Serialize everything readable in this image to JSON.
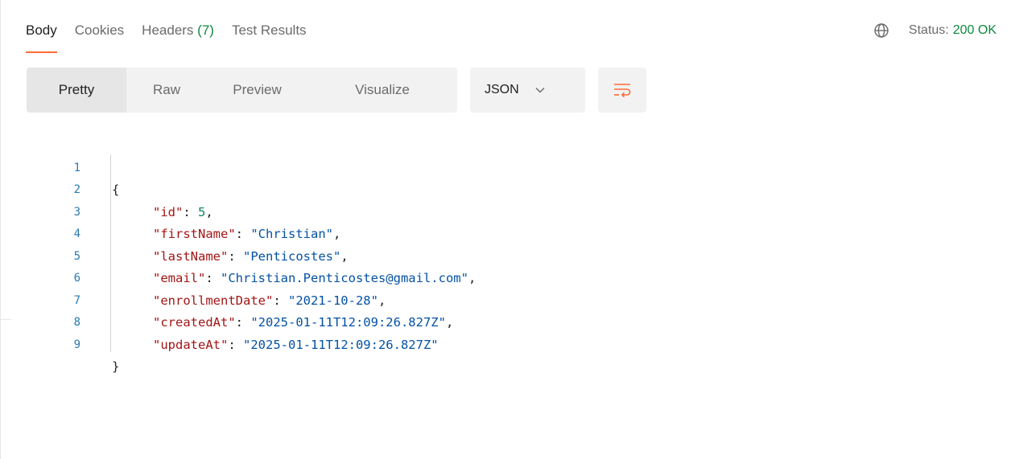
{
  "tabs": [
    {
      "label": "Body"
    },
    {
      "label": "Cookies"
    },
    {
      "label": "Headers",
      "count": "(7)"
    },
    {
      "label": "Test Results"
    }
  ],
  "status": {
    "label": "Status:",
    "value": "200 OK",
    "icon": "globe-icon"
  },
  "view_modes": [
    "Pretty",
    "Raw",
    "Preview",
    "Visualize"
  ],
  "format_select": {
    "value": "JSON",
    "icon": "chevron-down-icon"
  },
  "wrap_button": {
    "icon": "wrap-lines-icon",
    "color": "#ff6c37"
  },
  "code": {
    "line_numbers": [
      "1",
      "2",
      "3",
      "4",
      "5",
      "6",
      "7",
      "8",
      "9"
    ],
    "open_brace": "{",
    "close_brace": "}",
    "fields": [
      {
        "key": "\"id\"",
        "value": "5",
        "type": "number",
        "comma": ","
      },
      {
        "key": "\"firstName\"",
        "value": "\"Christian\"",
        "type": "string",
        "comma": ","
      },
      {
        "key": "\"lastName\"",
        "value": "\"Penticostes\"",
        "type": "string",
        "comma": ","
      },
      {
        "key": "\"email\"",
        "value": "\"Christian.Penticostes@gmail.com\"",
        "type": "string",
        "comma": ","
      },
      {
        "key": "\"enrollmentDate\"",
        "value": "\"2021-10-28\"",
        "type": "string",
        "comma": ","
      },
      {
        "key": "\"createdAt\"",
        "value": "\"2025-01-11T12:09:26.827Z\"",
        "type": "string",
        "comma": ","
      },
      {
        "key": "\"updateAt\"",
        "value": "\"2025-01-11T12:09:26.827Z\"",
        "type": "string",
        "comma": ""
      }
    ]
  },
  "colors": {
    "accent": "#ff6c37",
    "status_ok": "#0e8a3e",
    "json_key": "#a31515",
    "json_string": "#0451a5",
    "json_number": "#098658",
    "line_number": "#2a7ab0"
  }
}
